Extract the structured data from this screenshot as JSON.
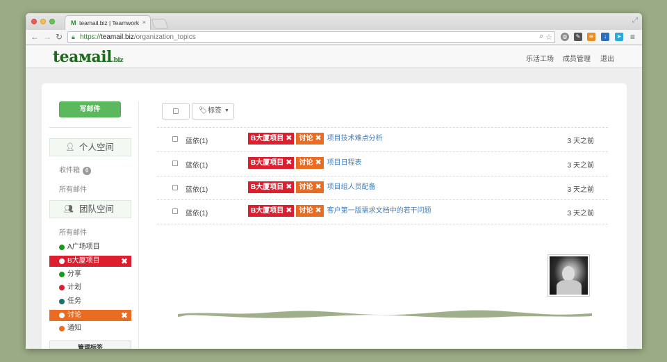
{
  "browser": {
    "tab_title": "teamail.biz | Teamwork w",
    "tab_favicon": "M",
    "tab_close": "×",
    "url_scheme": "https://",
    "url_host": "teamail.biz",
    "url_path": "/organization_topics"
  },
  "app": {
    "logo_main": "teaмail",
    "logo_suffix": ".biz",
    "nav": [
      "乐活工场",
      "成员管理",
      "退出"
    ]
  },
  "sidebar": {
    "compose_label": "写邮件",
    "personal_space": "个人空间",
    "inbox_label": "收件箱",
    "inbox_count": "0",
    "all_mail": "所有邮件",
    "team_space": "团队空间",
    "team_all_mail": "所有邮件",
    "labels": [
      {
        "name": "A广场项目",
        "color": "#1a9a1a",
        "active": false
      },
      {
        "name": "B大厦项目",
        "color": "#dd1e2f",
        "active": true
      },
      {
        "name": "分享",
        "color": "#1a9a1a",
        "active": false
      },
      {
        "name": "计划",
        "color": "#dd1e2f",
        "active": false
      },
      {
        "name": "任务",
        "color": "#1d6f6f",
        "active": false
      },
      {
        "name": "讨论",
        "color": "#ea6b22",
        "active": true
      },
      {
        "name": "通知",
        "color": "#ea6b22",
        "active": false
      }
    ],
    "manage_labels": "管理标签"
  },
  "toolbar": {
    "labels_button": "标签"
  },
  "threads": [
    {
      "sender": "蓝依(1)",
      "tags": [
        "B大厦项目",
        "讨论"
      ],
      "subject": "项目技术难点分析",
      "time": "3 天之前"
    },
    {
      "sender": "蓝依(1)",
      "tags": [
        "B大厦项目",
        "讨论"
      ],
      "subject": "项目日程表",
      "time": "3 天之前"
    },
    {
      "sender": "蓝依(1)",
      "tags": [
        "B大厦项目",
        "讨论"
      ],
      "subject": "项目组人员配备",
      "time": "3 天之前"
    },
    {
      "sender": "蓝依(1)",
      "tags": [
        "B大厦项目",
        "讨论"
      ],
      "subject": "客户第一版需求文档中的若干问题",
      "time": "3 天之前"
    }
  ],
  "colors": {
    "accent_green": "#5cb85c",
    "tag_red": "#dd1e2f",
    "tag_orange": "#ea6b22",
    "link_blue": "#3b7dc2"
  }
}
